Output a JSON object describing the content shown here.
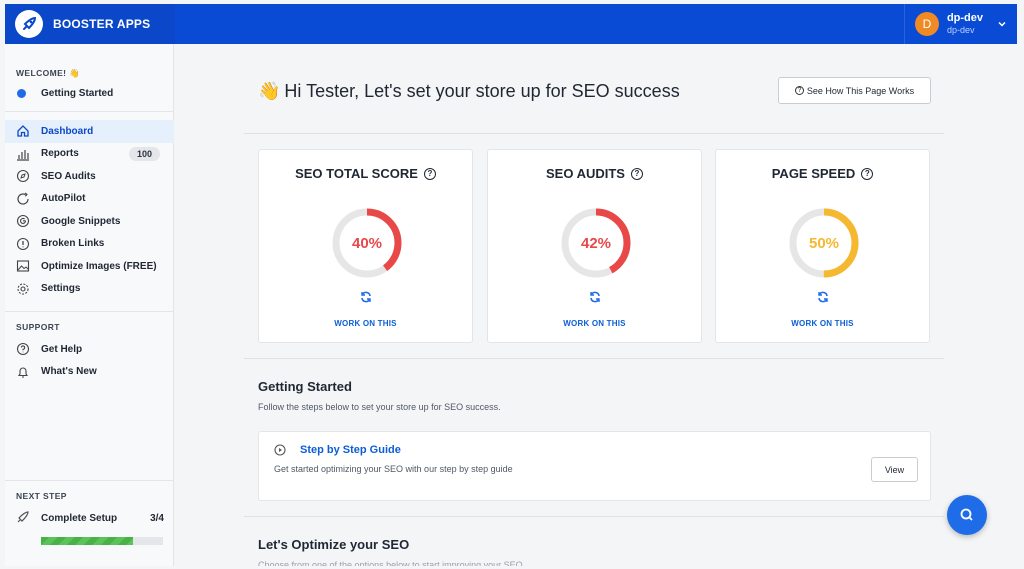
{
  "app": {
    "brand_name": "BOOSTER APPS"
  },
  "user": {
    "initial": "D",
    "name": "dp-dev",
    "store": "dp-dev"
  },
  "sidebar": {
    "welcome_title": "WELCOME! 👋",
    "getting_started": "Getting Started",
    "items": [
      {
        "label": "Dashboard",
        "icon": "home-icon",
        "active": true
      },
      {
        "label": "Reports",
        "icon": "chart-icon",
        "badge": "100"
      },
      {
        "label": "SEO Audits",
        "icon": "compass-icon"
      },
      {
        "label": "AutoPilot",
        "icon": "refresh-icon"
      },
      {
        "label": "Google Snippets",
        "icon": "google-icon"
      },
      {
        "label": "Broken Links",
        "icon": "alert-icon"
      },
      {
        "label": "Optimize Images (FREE)",
        "icon": "image-icon"
      },
      {
        "label": "Settings",
        "icon": "gear-icon"
      }
    ],
    "support_title": "SUPPORT",
    "support_items": [
      {
        "label": "Get Help",
        "icon": "help-icon"
      },
      {
        "label": "What's New",
        "icon": "bell-icon"
      }
    ],
    "next_step_title": "NEXT STEP",
    "next_step": {
      "label": "Complete Setup",
      "count": "3/4",
      "progress": 0.75
    }
  },
  "main": {
    "greeting": "Hi Tester, Let's set your store up for SEO success",
    "greeting_emoji": "👋",
    "how_button": "See How This Page Works",
    "cards": [
      {
        "title": "SEO TOTAL SCORE",
        "value": 40,
        "value_label": "40%",
        "color": "#e84848",
        "action": "WORK ON THIS"
      },
      {
        "title": "SEO AUDITS",
        "value": 42,
        "value_label": "42%",
        "color": "#e84848",
        "action": "WORK ON THIS"
      },
      {
        "title": "PAGE SPEED",
        "value": 50,
        "value_label": "50%",
        "color": "#f5b82e",
        "action": "WORK ON THIS"
      }
    ],
    "getting_started": {
      "title": "Getting Started",
      "subtitle": "Follow the steps below to set your store up for SEO success.",
      "guide_title": "Step by Step Guide",
      "guide_subtitle": "Get started optimizing your SEO with our step by step guide",
      "view_button": "View"
    },
    "optimize": {
      "title": "Let's Optimize your SEO",
      "subtitle": "Choose from one of the options below to start improving your SEO"
    }
  },
  "colors": {
    "primary": "#0b47c9",
    "accent": "#1e6ce8",
    "danger": "#e84848",
    "warning": "#f5b82e",
    "success": "#4cb04a"
  }
}
